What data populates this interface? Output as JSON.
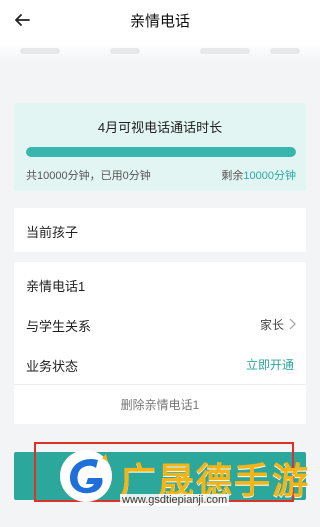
{
  "header": {
    "title": "亲情电话"
  },
  "time_card": {
    "title": "4月可视电话通话时长",
    "usage_fraction": 0.0,
    "total_text": "共10000分钟，已用0分钟",
    "remaining_prefix": "剩余",
    "remaining_value": "10000分钟"
  },
  "current_child": {
    "label": "当前孩子"
  },
  "contact": {
    "name": "亲情电话1",
    "relation_label": "与学生关系",
    "relation_value": "家长",
    "status_label": "业务状态",
    "status_action": "立即开通",
    "delete_label": "删除亲情电话1"
  },
  "watermark": {
    "brand": "广晟德手游",
    "url": "www.gsdtiepianji.com"
  },
  "colors": {
    "accent": "#2ba79c",
    "progress": "#37b6ae",
    "card_bg": "#e2f5f3",
    "highlight_box": "#e0302b",
    "brand_yellow": "#f5b415",
    "logo_blue": "#1e6fd9"
  }
}
